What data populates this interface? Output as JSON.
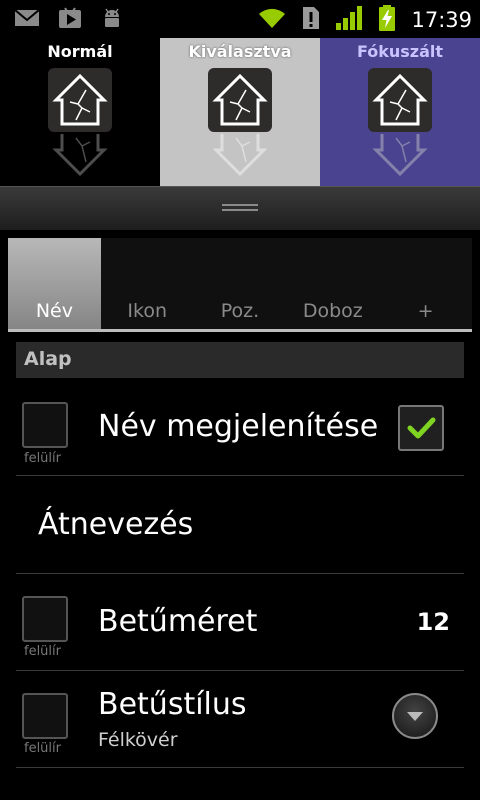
{
  "status_bar": {
    "time": "17:39",
    "left_icons": [
      "gmail-icon",
      "play-store-icon",
      "android-debug-icon"
    ],
    "right_icons": [
      "wifi-icon",
      "alert-icon",
      "signal-icon",
      "battery-charging-icon"
    ]
  },
  "preview": {
    "normal_label": "Normál",
    "selected_label": "Kiválasztva",
    "focused_label": "Fókuszált",
    "colors": {
      "normal": "#000000",
      "selected": "#c4c4c4",
      "focused": "#4a4390"
    }
  },
  "tabs": [
    {
      "label": "Név",
      "active": true
    },
    {
      "label": "Ikon",
      "active": false
    },
    {
      "label": "Poz.",
      "active": false
    },
    {
      "label": "Doboz",
      "active": false
    },
    {
      "label": "+",
      "active": false
    }
  ],
  "section": {
    "title": "Alap"
  },
  "rows": {
    "show_name": {
      "title": "Név megjelenítése",
      "override_label": "felülír",
      "checked": true
    },
    "rename": {
      "title": "Átnevezés"
    },
    "font_size": {
      "title": "Betűméret",
      "override_label": "felülír",
      "value": "12"
    },
    "font_style": {
      "title": "Betűstílus",
      "override_label": "felülír",
      "value": "Félkövér"
    }
  },
  "accent_colors": {
    "check": "#7fd321",
    "signal": "#99cc00"
  }
}
